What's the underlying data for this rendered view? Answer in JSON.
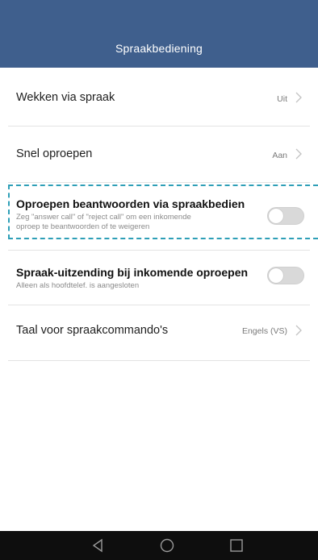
{
  "header": {
    "title": "Spraakbediening",
    "bg_color": "#3f5f8d"
  },
  "settings": [
    {
      "label": "Wekken via spraak",
      "value": "Uit",
      "control": "chevron"
    },
    {
      "label": "Snel oproepen",
      "value": "Aan",
      "control": "chevron"
    },
    {
      "label": "Oproepen beantwoorden via spraakbedien",
      "sub_line1": "Zeg \"answer call\" of \"reject call\" om een inkomende",
      "sub_line2": "oproep te beantwoorden of te weigeren",
      "control": "toggle",
      "state": "off",
      "highlighted": true
    },
    {
      "label": "Spraak-uitzending bij inkomende oproepen",
      "sub_line1": "Alleen als hoofdtelef. is aangesloten",
      "control": "toggle",
      "state": "off"
    },
    {
      "label": "Taal voor spraakcommando's",
      "value": "Engels (VS)",
      "control": "chevron"
    }
  ],
  "navbar": {
    "icons": [
      "back-icon",
      "home-icon",
      "recents-icon"
    ]
  },
  "colors": {
    "highlight_dash": "#2e9fb7",
    "toggle_off": "#d9d9d9"
  }
}
